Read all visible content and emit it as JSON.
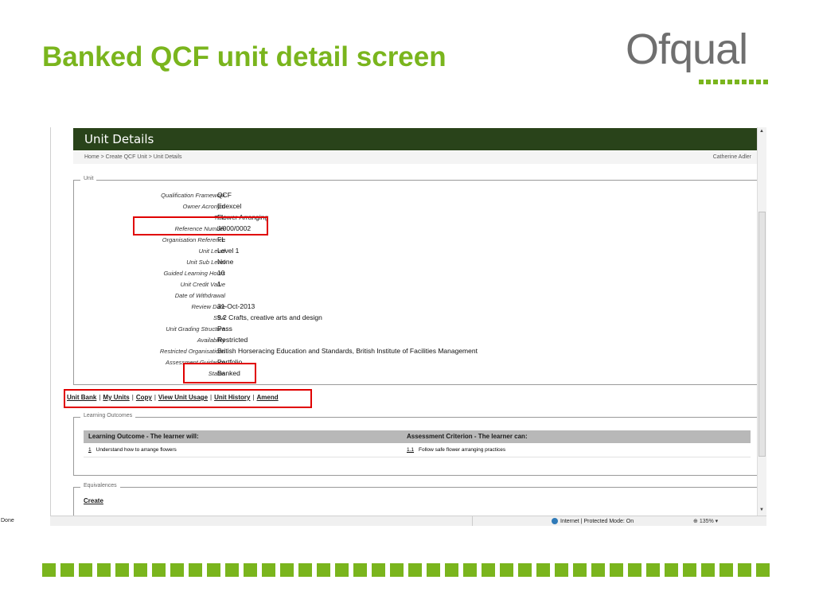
{
  "slide": {
    "title": "Banked QCF unit detail screen",
    "logo_text": "Ofqual",
    "accent_color": "#7ab51d"
  },
  "page": {
    "header_title": "Unit Details",
    "breadcrumb": "Home > Create QCF Unit > Unit Details",
    "user_name": "Catherine Adler"
  },
  "unit": {
    "legend": "Unit",
    "fields": [
      {
        "label": "Qualification Framework",
        "value": "QCF"
      },
      {
        "label": "Owner Acronym",
        "value": "Edexcel"
      },
      {
        "label": "Title",
        "value": "Flower Arranging"
      },
      {
        "label": "Reference Number",
        "value": "J/000/0002"
      },
      {
        "label": "Organisation Reference",
        "value": "FL"
      },
      {
        "label": "Unit Level",
        "value": "Level 1"
      },
      {
        "label": "Unit Sub Level",
        "value": "None"
      },
      {
        "label": "Guided Learning Hours",
        "value": "10"
      },
      {
        "label": "Unit Credit Value",
        "value": "1"
      },
      {
        "label": "Date of Withdrawal",
        "value": ""
      },
      {
        "label": "Review Date",
        "value": "31-Oct-2013"
      },
      {
        "label": "SSA",
        "value": "9.2 Crafts, creative arts and design"
      },
      {
        "label": "Unit Grading Structure",
        "value": "Pass"
      },
      {
        "label": "Availability",
        "value": "Restricted"
      },
      {
        "label": "Restricted Organisations",
        "value": "British Horseracing Education and Standards, British Institute of Facilities Management"
      },
      {
        "label": "Assessment Guidance",
        "value": "Portfolio"
      },
      {
        "label": "Status",
        "value": "Banked"
      }
    ]
  },
  "actions": [
    "Unit Bank",
    "My Units",
    "Copy",
    "View Unit Usage",
    "Unit History",
    "Amend"
  ],
  "learning_outcomes": {
    "legend": "Learning Outcomes",
    "col_outcome": "Learning Outcome - The learner will:",
    "col_criterion": "Assessment Criterion - The learner can:",
    "rows": [
      {
        "num": "1",
        "outcome": "Understand how to arrange flowers",
        "crit_num": "1.1",
        "criterion": "Follow safe flower arranging practices"
      }
    ]
  },
  "equivalences": {
    "legend": "Equivalences",
    "create_label": "Create"
  },
  "statusbar": {
    "left": "Done",
    "zone": "Internet | Protected Mode: On",
    "zoom": "135%"
  }
}
